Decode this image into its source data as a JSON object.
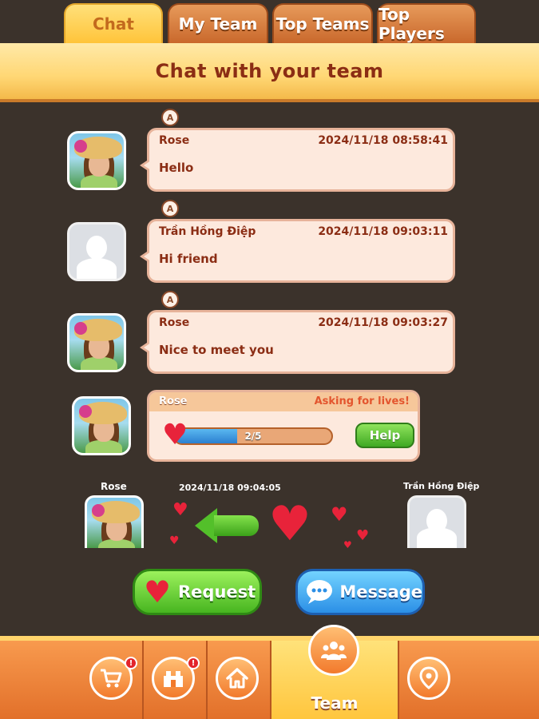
{
  "tabs": [
    {
      "label": "Chat",
      "active": true
    },
    {
      "label": "My Team",
      "active": false
    },
    {
      "label": "Top Teams",
      "active": false
    },
    {
      "label": "Top Players",
      "active": false
    }
  ],
  "banner": {
    "title": "Chat with your team"
  },
  "messages": [
    {
      "sender": "Rose",
      "timestamp": "2024/11/18 08:58:41",
      "text": "Hello",
      "avatar": "rose"
    },
    {
      "sender": "Trần Hồng Điệp",
      "timestamp": "2024/11/18 09:03:11",
      "text": "Hi friend",
      "avatar": "blank"
    },
    {
      "sender": "Rose",
      "timestamp": "2024/11/18 09:03:27",
      "text": "Nice to meet you",
      "avatar": "rose"
    }
  ],
  "lives_request": {
    "sender": "Rose",
    "status": "Asking for lives!",
    "progress_text": "2/5",
    "progress_fraction": 0.4,
    "help_label": "Help"
  },
  "gift": {
    "from": "Rose",
    "timestamp": "2024/11/18 09:04:05",
    "to": "Trần Hồng Điệp"
  },
  "actions": {
    "request_label": "Request",
    "message_label": "Message"
  },
  "bottom_nav": {
    "team_label": "Team",
    "alert_mark": "!"
  },
  "colors": {
    "background": "#3b322b",
    "banner": "#ffd774",
    "text_brown": "#8b2d14",
    "request_green": "#47b520",
    "message_blue": "#2b8fe6",
    "nav_orange": "#f27a2c"
  }
}
